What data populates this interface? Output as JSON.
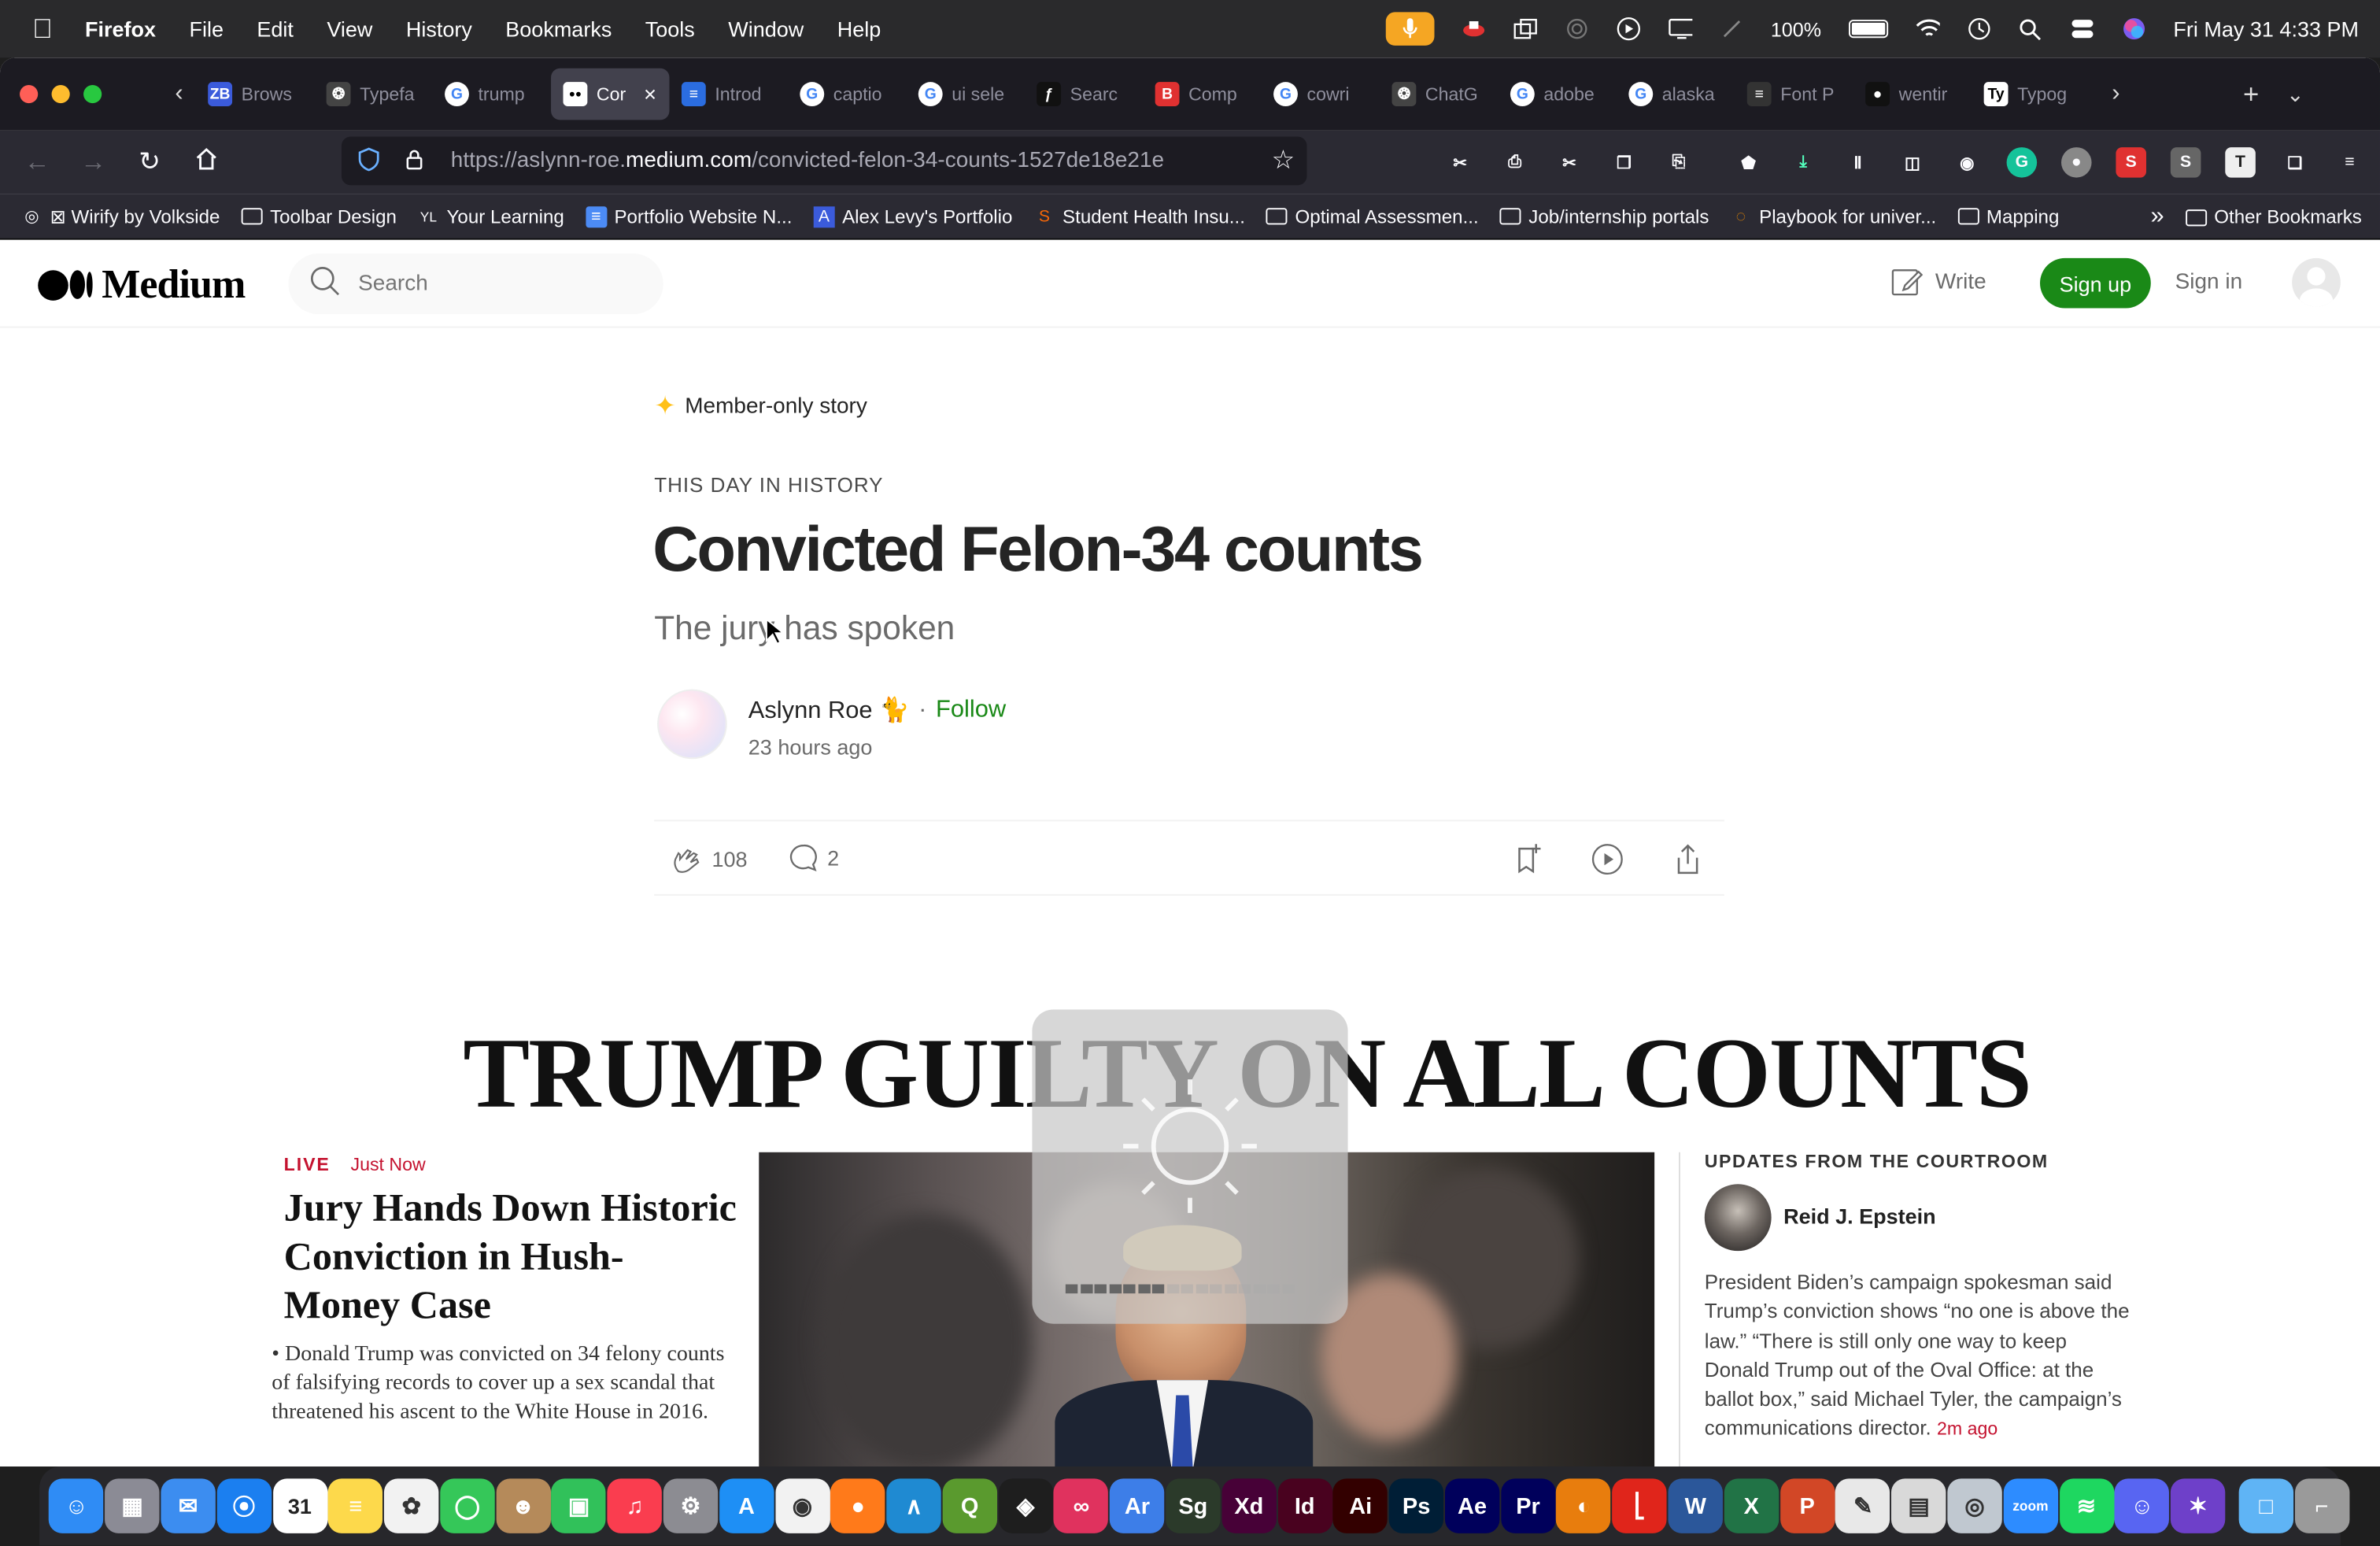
{
  "menubar": {
    "app": "Firefox",
    "items": [
      "File",
      "Edit",
      "View",
      "History",
      "Bookmarks",
      "Tools",
      "Window",
      "Help"
    ],
    "battery": "100%",
    "clock": "Fri May 31  4:33 PM"
  },
  "tabs": [
    {
      "label": "Brows",
      "icon": "zb-logo",
      "color": "#3b5bdb"
    },
    {
      "label": "Typefa",
      "icon": "openai-logo",
      "color": "#444"
    },
    {
      "label": "trump",
      "icon": "google-logo",
      "color": "#fff"
    },
    {
      "label": "Cor",
      "icon": "medium-logo",
      "color": "#000",
      "active": true
    },
    {
      "label": "Introd",
      "icon": "doc-icon",
      "color": "#2b6de0"
    },
    {
      "label": "captio",
      "icon": "google-logo",
      "color": "#fff"
    },
    {
      "label": "ui sele",
      "icon": "google-logo",
      "color": "#fff"
    },
    {
      "label": "Searc",
      "icon": "script-f-icon",
      "color": "#111"
    },
    {
      "label": "Comp",
      "icon": "b-logo",
      "color": "#e03131"
    },
    {
      "label": "cowri",
      "icon": "google-logo",
      "color": "#fff"
    },
    {
      "label": "ChatG",
      "icon": "openai-logo",
      "color": "#444"
    },
    {
      "label": "adobe",
      "icon": "google-logo",
      "color": "#fff"
    },
    {
      "label": "alaska",
      "icon": "google-logo",
      "color": "#fff"
    },
    {
      "label": "Font P",
      "icon": "sliders-icon",
      "color": "#333"
    },
    {
      "label": "wentir",
      "icon": "github-icon",
      "color": "#111"
    },
    {
      "label": "Typog",
      "icon": "ty-logo",
      "color": "#fff"
    }
  ],
  "url": {
    "prefix": "https://aslynn-roe.",
    "domain": "medium.com",
    "path": "/convicted-felon-34-counts-1527de18e21e"
  },
  "bookmarks": [
    {
      "label": "⊠ Wirify by Volkside",
      "icon": "globe-icon"
    },
    {
      "label": "Toolbar Design",
      "icon": "folder-icon"
    },
    {
      "label": "Your Learning",
      "icon": "yl-icon"
    },
    {
      "label": "Portfolio Website N...",
      "icon": "doc-icon"
    },
    {
      "label": "Alex Levy's Portfolio",
      "icon": "a-icon"
    },
    {
      "label": "Student Health Insu...",
      "icon": "s-icon"
    },
    {
      "label": "Optimal Assessmen...",
      "icon": "folder-icon"
    },
    {
      "label": "Job/internship portals",
      "icon": "folder-icon"
    },
    {
      "label": "Playbook for univer...",
      "icon": "dotted-circle-icon"
    },
    {
      "label": "Mapping",
      "icon": "folder-icon"
    }
  ],
  "other_bookmarks": "Other Bookmarks",
  "medium": {
    "brand": "Medium",
    "search_placeholder": "Search",
    "write": "Write",
    "signup": "Sign up",
    "signin": "Sign in"
  },
  "article": {
    "member": "Member-only story",
    "kicker": "THIS DAY IN HISTORY",
    "title": "Convicted Felon-34 counts",
    "subtitle": "The jury has spoken",
    "author": "Aslynn Roe 🐈",
    "follow": "Follow",
    "posted": "23 hours ago",
    "claps": "108",
    "comments": "2"
  },
  "news": {
    "headline": "TRUMP GUILTY ON ALL COUNTS",
    "live": "LIVE",
    "justnow": "Just Now",
    "lead_head": "Jury Hands Down Historic Conviction in Hush-Money Case",
    "lead_body": "• Donald Trump was convicted on 34 felony counts of falsifying records to cover up a sex scandal that threatened his ascent to the White House in 2016.",
    "updates_label": "UPDATES FROM THE COURTROOM",
    "reporter": "Reid J. Epstein",
    "update_body": "President Biden’s campaign spokesman said Trump’s conviction shows “no one is above the law.” “There is still only one way to keep Donald Trump out of the Oval Office: at the ballot box,” said Michael Tyler, the campaign’s communications director.",
    "update_ago": "2m ago"
  },
  "brightness": {
    "level": 0.45,
    "segments": 16
  },
  "colors": {
    "medium_green": "#1a8917",
    "nyt_red": "#c4122f",
    "firefox_dark": "#2b2a33"
  },
  "dock": [
    {
      "name": "finder",
      "color": "#2f8cf5",
      "label": "☺"
    },
    {
      "name": "launchpad",
      "color": "#8b8b95",
      "label": "▦"
    },
    {
      "name": "mail",
      "color": "#3c8df0",
      "label": "✉"
    },
    {
      "name": "safari",
      "color": "#1b7ff0",
      "label": "⦿"
    },
    {
      "name": "calendar",
      "color": "#ffffff",
      "label": "31"
    },
    {
      "name": "notes",
      "color": "#fdd94b",
      "label": "≡"
    },
    {
      "name": "photos",
      "color": "#f2f2f2",
      "label": "✿"
    },
    {
      "name": "messages",
      "color": "#35c759",
      "label": "◯"
    },
    {
      "name": "contacts",
      "color": "#b58a5a",
      "label": "☻"
    },
    {
      "name": "facetime",
      "color": "#31c15a",
      "label": "▣"
    },
    {
      "name": "music",
      "color": "#fa3d4f",
      "label": "♫"
    },
    {
      "name": "settings",
      "color": "#8c8c92",
      "label": "⚙"
    },
    {
      "name": "app-store",
      "color": "#1e8ff5",
      "label": "A"
    },
    {
      "name": "chrome",
      "color": "#f2f2f2",
      "label": "◉"
    },
    {
      "name": "firefox",
      "color": "#ff7a1a",
      "label": "●"
    },
    {
      "name": "vscode",
      "color": "#1f8ad2",
      "label": "∧"
    },
    {
      "name": "qgis",
      "color": "#5a9a2e",
      "label": "Q"
    },
    {
      "name": "figma",
      "color": "#1e1e1e",
      "label": "◈"
    },
    {
      "name": "creative-cloud",
      "color": "#e0325e",
      "label": "∞"
    },
    {
      "name": "ar",
      "color": "#3d7ee8",
      "label": "Ar"
    },
    {
      "name": "sketchup",
      "color": "#2b3a2a",
      "label": "Sg"
    },
    {
      "name": "xd",
      "color": "#470137",
      "label": "Xd"
    },
    {
      "name": "indesign",
      "color": "#49021f",
      "label": "Id"
    },
    {
      "name": "illustrator",
      "color": "#330000",
      "label": "Ai"
    },
    {
      "name": "photoshop",
      "color": "#001e36",
      "label": "Ps"
    },
    {
      "name": "after-effects",
      "color": "#00005b",
      "label": "Ae"
    },
    {
      "name": "premiere",
      "color": "#00005b",
      "label": "Pr"
    },
    {
      "name": "blender",
      "color": "#e87d0d",
      "label": "◐"
    },
    {
      "name": "acrobat",
      "color": "#e0251b",
      "label": "⎣"
    },
    {
      "name": "word",
      "color": "#2b579a",
      "label": "W"
    },
    {
      "name": "excel",
      "color": "#217346",
      "label": "X"
    },
    {
      "name": "powerpoint",
      "color": "#d24726",
      "label": "P"
    },
    {
      "name": "textedit",
      "color": "#e8e8e8",
      "label": "✎"
    },
    {
      "name": "preview",
      "color": "#d9d9d9",
      "label": "▤"
    },
    {
      "name": "screenshot",
      "color": "#c0c8d0",
      "label": "◎"
    },
    {
      "name": "zoom",
      "color": "#2d8cff",
      "label": "zoom"
    },
    {
      "name": "spotify",
      "color": "#1ed760",
      "label": "≋"
    },
    {
      "name": "discord",
      "color": "#5865f2",
      "label": "☺"
    },
    {
      "name": "github-desktop",
      "color": "#6e40c9",
      "label": "✶"
    },
    {
      "name": "downloads-folder",
      "color": "#5fb4f5",
      "label": "□"
    },
    {
      "name": "trash",
      "color": "#9a9a9a",
      "label": "⌐"
    }
  ]
}
